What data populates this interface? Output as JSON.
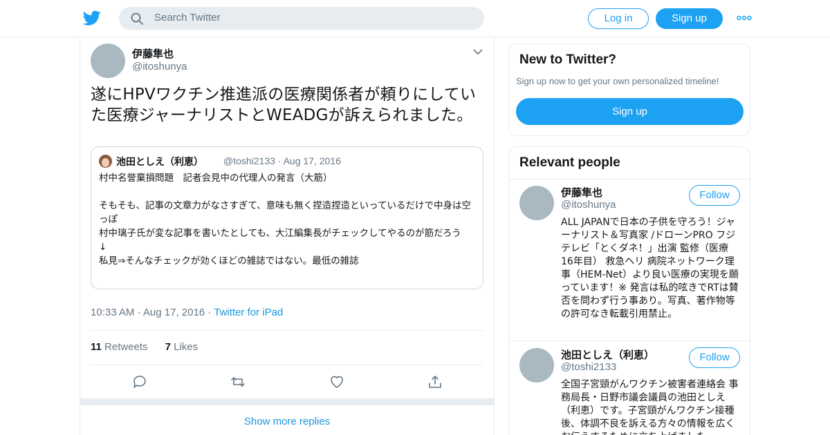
{
  "header": {
    "search_placeholder": "Search Twitter",
    "login_label": "Log in",
    "signup_label": "Sign up"
  },
  "tweet": {
    "author_name": "伊藤隼也",
    "author_handle": "@itoshunya",
    "text": "遂にHPVワクチン推進派の医療関係者が頼りにしていた医療ジャーナリストとWEADGが訴えられました。",
    "quote": {
      "name": "池田としえ（利恵）",
      "meta": "@toshi2133 · Aug 17, 2016",
      "body": "村中名誉棄損問題　記者会見中の代理人の発言（大筋）\n\nそもそも、記事の文章力がなさすぎて、意味も無く捏造捏造といっているだけで中身は空っぽ\n村中璃子氏が変な記事を書いたとしても、大江編集長がチェックしてやるのが筋だろう\n↓\n私見⇒そんなチェックが効くほどの雑誌ではない。最低の雑誌"
    },
    "time": "10:33 AM",
    "date": "Aug 17, 2016",
    "source": "Twitter for iPad",
    "retweets_count": "11",
    "retweets_label": "Retweets",
    "likes_count": "7",
    "likes_label": "Likes"
  },
  "show_more_label": "Show more replies",
  "sidebar": {
    "new_title": "New to Twitter?",
    "new_subtitle": "Sign up now to get your own personalized timeline!",
    "new_signup_label": "Sign up",
    "relevant_title": "Relevant people",
    "people": [
      {
        "name": "伊藤隼也",
        "handle": "@itoshunya",
        "follow_label": "Follow",
        "bio": "ALL JAPANで日本の子供を守ろう！ジャーナリスト＆写真家 /ドローンPRO フジテレビ「とくダネ！」出演 監修（医療 16年目） 救急ヘリ 病院ネットワーク理事（HEM-Net）より良い医療の実現を願っています！※ 発言は私的呟きでRTは賛否を問わず行う事あり。写真、著作物等の許可なき転載引用禁止。"
      },
      {
        "name": "池田としえ（利恵）",
        "handle": "@toshi2133",
        "follow_label": "Follow",
        "bio": "全国子宮頸がんワクチン被害者連絡会 事務局長・日野市議会議員の池田としえ（利恵）です。子宮頸がんワクチン接種後、体調不良を訴える方々の情報を広くお伝えするために立ち上げました。"
      }
    ]
  },
  "colors": {
    "brand": "#1da1f2",
    "link": "#1b95e0",
    "muted": "#657786",
    "border": "#e6ecf0"
  },
  "icons": [
    "twitter-bird-icon",
    "search-icon",
    "more-dots-icon",
    "chevron-down-icon",
    "reply-icon",
    "retweet-icon",
    "like-icon",
    "share-icon"
  ]
}
